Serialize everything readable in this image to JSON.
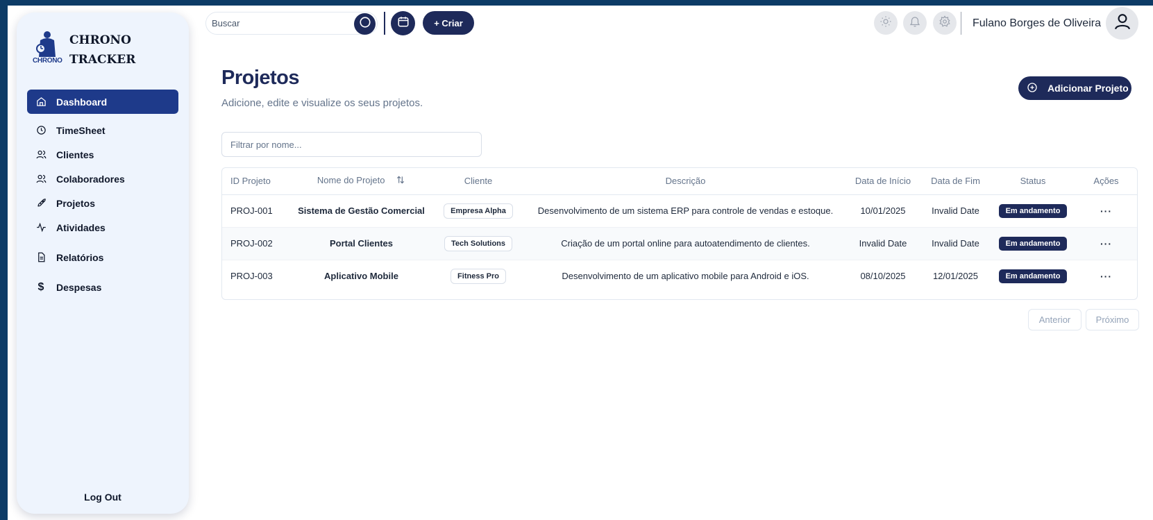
{
  "brand": {
    "name_line1": "CHRONO",
    "name_line2": "TRACKER",
    "logo_text": "CHRONO"
  },
  "sidebar": {
    "items": [
      {
        "label": "Dashboard",
        "icon": "home-icon",
        "active": true
      },
      {
        "label": "TimeSheet",
        "icon": "clock-icon"
      },
      {
        "label": "Clientes",
        "icon": "users-icon"
      },
      {
        "label": "Colaboradores",
        "icon": "users-icon"
      },
      {
        "label": "Projetos",
        "icon": "rocket-icon"
      },
      {
        "label": "Atividades",
        "icon": "activity-icon"
      },
      {
        "label": "Relatórios",
        "icon": "file-text-icon"
      },
      {
        "label": "Despesas",
        "icon": "dollar-icon"
      }
    ],
    "logout_label": "Log Out"
  },
  "topbar": {
    "search_placeholder": "Buscar",
    "create_label": "+ Criar",
    "user_name": "Fulano Borges de Oliveira",
    "icons": [
      "search-icon",
      "calendar-icon",
      "sun-icon",
      "bell-icon",
      "gear-icon",
      "user-icon"
    ]
  },
  "page": {
    "title": "Projetos",
    "subtitle": "Adicione, edite e visualize os seus projetos.",
    "add_button_label": "Adicionar Projeto",
    "filter_placeholder": "Filtrar por nome..."
  },
  "table": {
    "columns": [
      "ID Projeto",
      "Nome do Projeto",
      "Cliente",
      "Descrição",
      "Data de Início",
      "Data de Fim",
      "Status",
      "Ações"
    ],
    "rows": [
      {
        "id": "PROJ-001",
        "name": "Sistema de Gestão Comercial",
        "client": "Empresa Alpha",
        "description": "Desenvolvimento de um sistema ERP para controle de vendas e estoque.",
        "start": "10/01/2025",
        "end": "Invalid Date",
        "status": "Em andamento",
        "actions": "···"
      },
      {
        "id": "PROJ-002",
        "name": "Portal Clientes",
        "client": "Tech Solutions",
        "description": "Criação de um portal online para autoatendimento de clientes.",
        "start": "Invalid Date",
        "end": "Invalid Date",
        "status": "Em andamento",
        "actions": "···"
      },
      {
        "id": "PROJ-003",
        "name": "Aplicativo Mobile",
        "client": "Fitness Pro",
        "description": "Desenvolvimento de um aplicativo mobile para Android e iOS.",
        "start": "08/10/2025",
        "end": "12/01/2025",
        "status": "Em andamento",
        "actions": "···"
      }
    ]
  },
  "pagination": {
    "prev_label": "Anterior",
    "next_label": "Próximo"
  },
  "colors": {
    "primary": "#1e2a5a",
    "active_nav": "#1e3a8a",
    "sidebar_bg": "#eef4fd",
    "frame": "#0d3b66"
  }
}
